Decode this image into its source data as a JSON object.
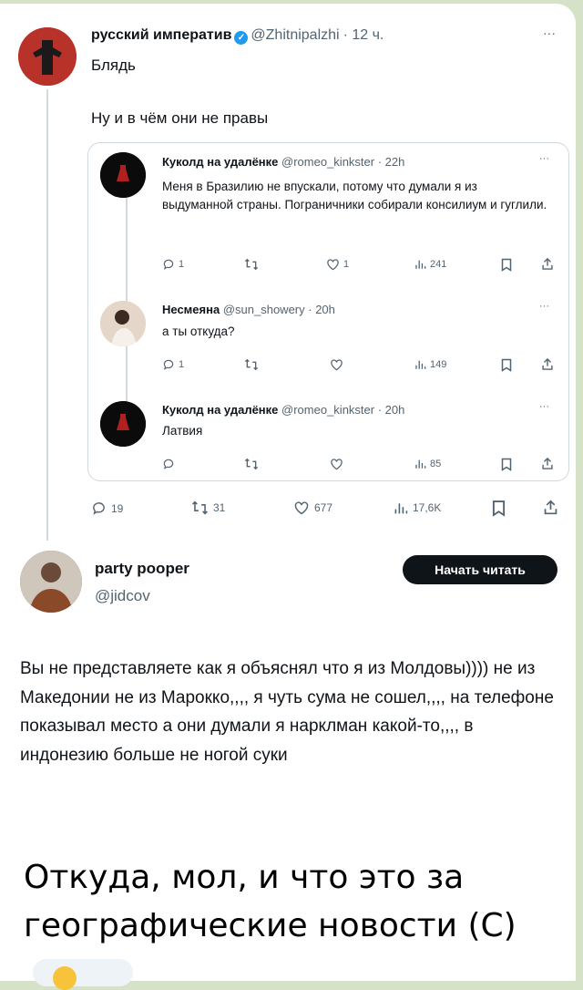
{
  "main_tweet": {
    "author_name": "русский императив",
    "handle": "@Zhitnipalzhi",
    "time": "· 12 ч.",
    "more": "···",
    "line1": "Блядь",
    "line2": "Ну и в чём они не правы"
  },
  "quoted": [
    {
      "name": "Куколд на удалёнке",
      "handle": "@romeo_kinkster",
      "time": "· 22h",
      "more": "···",
      "text": "Меня в Бразилию не впускали, потому что думали я из выдуманной страны. Пограничники собирали консилиум и гуглили.",
      "replies": "1",
      "retweets": "",
      "likes": "1",
      "views": "241"
    },
    {
      "name": "Несмеяна",
      "handle": "@sun_showery",
      "time": "· 20h",
      "more": "···",
      "text": "а ты откуда?",
      "replies": "1",
      "retweets": "",
      "likes": "",
      "views": "149"
    },
    {
      "name": "Куколд на удалёнке",
      "handle": "@romeo_kinkster",
      "time": "· 20h",
      "more": "···",
      "text": "Латвия",
      "replies": "",
      "retweets": "",
      "likes": "",
      "views": "85"
    }
  ],
  "main_stats": {
    "replies": "19",
    "retweets": "31",
    "likes": "677",
    "views": "17,6K"
  },
  "reply_tweet": {
    "author_name": "party pooper",
    "handle": "@jidcov",
    "follow_button": "Начать читать",
    "text": "Вы не представляете как я объяснял что я из Молдовы)))) не из Македонии не из Марокко,,,, я чуть сума не сошел,,,, на телефоне показывал место а они думали я нарклман какой-то,,,, в индонезию больше не ногой суки"
  },
  "caption": "Откуда, мол, и  что  это за географические новости (С)",
  "colors": {
    "text": "#0f1419",
    "secondary": "#536471",
    "verified": "#1d9bf0",
    "border": "#cfd9de",
    "background": "#d6e2c8"
  }
}
